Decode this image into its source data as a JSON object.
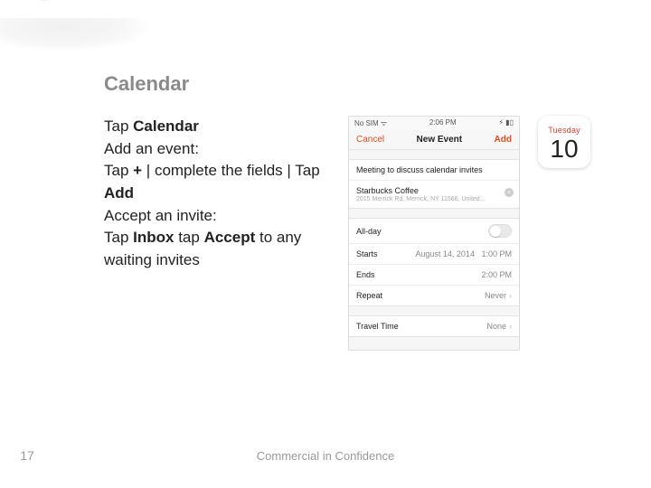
{
  "slide": {
    "title": "Calendar",
    "page_number": "17",
    "footer": "Commercial in Confidence"
  },
  "instructions": {
    "l1a": "Tap ",
    "l1b": "Calendar",
    "l2": "Add an event:",
    "l3a": "Tap ",
    "l3b": "+",
    "l3c": " | complete the fields | Tap ",
    "l3d": "Add",
    "l4": "Accept an invite:",
    "l5a": "Tap ",
    "l5b": "Inbox",
    "l5c": " tap ",
    "l5d": "Accept",
    "l5e": " to any waiting invites"
  },
  "phone": {
    "status_left": "No SIM ᯤ",
    "status_time": "2:06 PM",
    "status_right": "⚡︎ ▮▯",
    "nav_cancel": "Cancel",
    "nav_title": "New Event",
    "nav_add": "Add",
    "event_title": "Meeting to discuss calendar invites",
    "loc_name": "Starbucks Coffee",
    "loc_addr": "2015 Merrick Rd, Merrick, NY 11566, United...",
    "allday": "All-day",
    "starts_lbl": "Starts",
    "starts_date": "August 14, 2014",
    "starts_time": "1:00 PM",
    "ends_lbl": "Ends",
    "ends_time": "2:00 PM",
    "repeat_lbl": "Repeat",
    "repeat_val": "Never",
    "travel_lbl": "Travel Time",
    "travel_val": "None"
  },
  "calendar_icon": {
    "day_of_week": "Tuesday",
    "day_number": "10"
  }
}
